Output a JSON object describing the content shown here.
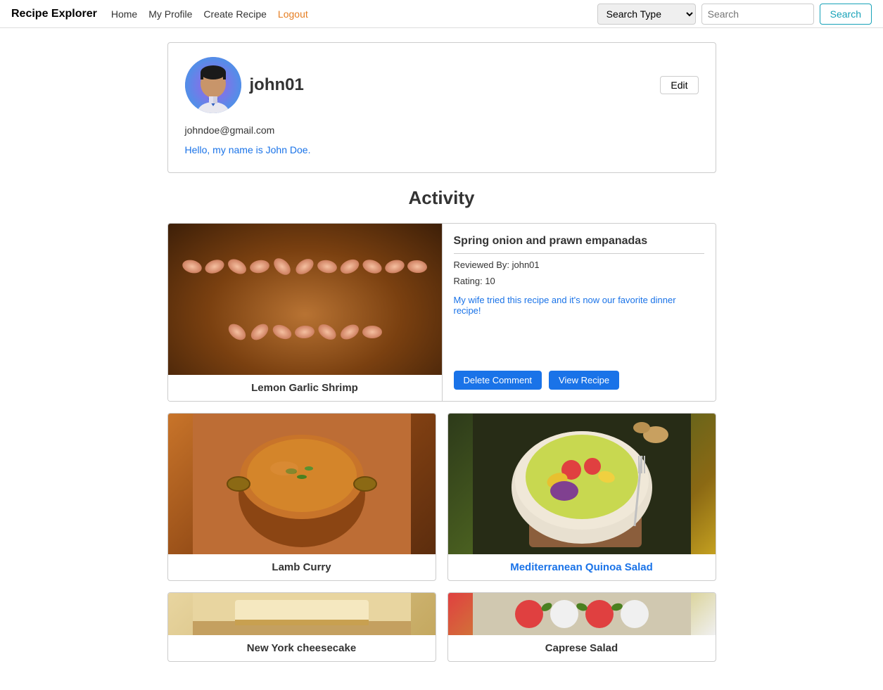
{
  "navbar": {
    "brand": "Recipe Explorer",
    "links": [
      {
        "label": "Home",
        "href": "#"
      },
      {
        "label": "My Profile",
        "href": "#"
      },
      {
        "label": "Create Recipe",
        "href": "#"
      },
      {
        "label": "Logout",
        "href": "#",
        "class": "logout"
      }
    ],
    "search": {
      "type_placeholder": "Search Type",
      "input_placeholder": "Search",
      "button_label": "Search"
    }
  },
  "profile": {
    "username": "john01",
    "email": "johndoe@gmail.com",
    "bio": "Hello, my name is John Doe.",
    "edit_label": "Edit"
  },
  "activity": {
    "title": "Activity",
    "items": [
      {
        "type": "reviewed",
        "recipe_name": "Lemon Garlic Shrimp",
        "review_title": "Spring onion and prawn empanadas",
        "reviewed_by": "john01",
        "rating": "10",
        "comment": "My wife tried this recipe and it's now our favorite dinner recipe!",
        "delete_label": "Delete Comment",
        "view_label": "View Recipe"
      },
      {
        "type": "card",
        "recipe_name": "Lamb Curry",
        "color": "normal"
      },
      {
        "type": "card",
        "recipe_name": "Mediterranean Quinoa Salad",
        "color": "blue"
      },
      {
        "type": "card",
        "recipe_name": "New York cheesecake",
        "color": "normal"
      },
      {
        "type": "card",
        "recipe_name": "Caprese Salad",
        "color": "normal"
      }
    ]
  }
}
